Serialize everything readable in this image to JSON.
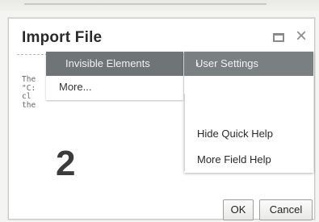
{
  "dialog": {
    "title": "Import File",
    "ok_label": "OK",
    "cancel_label": "Cancel"
  },
  "background_text": {
    "lines": [
      "The",
      "\"C:",
      "cl",
      "the"
    ],
    "partial": "..."
  },
  "step_label": "2",
  "menu_left": {
    "header": "Invisible Elements",
    "items": [
      "More..."
    ]
  },
  "menu_right": {
    "header": "User Settings",
    "items": [
      "Hide Quick Help",
      "More Field Help"
    ]
  },
  "icons": [
    "maximize-icon",
    "close-icon",
    "chevron-right-icon"
  ]
}
